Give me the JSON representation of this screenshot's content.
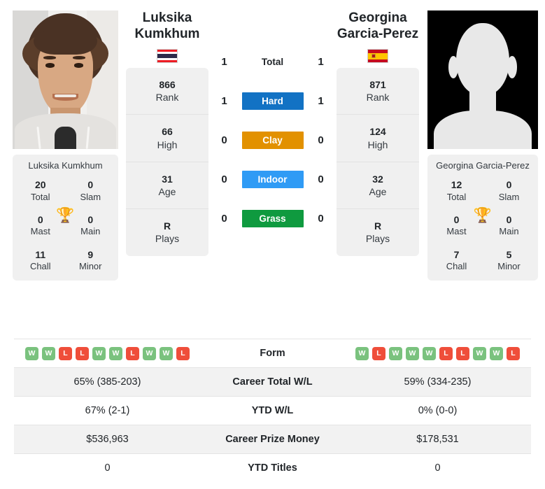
{
  "players": {
    "left": {
      "name_line1": "Luksika",
      "name_line2": "Kumkhum",
      "full_name": "Luksika Kumkhum",
      "flag": "thailand-flag",
      "photo": "player-portrait-photo",
      "rank": "866",
      "rank_label": "Rank",
      "high": "66",
      "high_label": "High",
      "age": "31",
      "age_label": "Age",
      "plays": "R",
      "plays_label": "Plays",
      "titles": {
        "total": "20",
        "total_label": "Total",
        "slam": "0",
        "slam_label": "Slam",
        "mast": "0",
        "mast_label": "Mast",
        "main": "0",
        "main_label": "Main",
        "chall": "11",
        "chall_label": "Chall",
        "minor": "9",
        "minor_label": "Minor"
      },
      "form": [
        "W",
        "W",
        "L",
        "L",
        "W",
        "W",
        "L",
        "W",
        "W",
        "L"
      ],
      "career_total_wl": "65% (385-203)",
      "ytd_wl": "67% (2-1)",
      "career_prize_money": "$536,963",
      "ytd_titles": "0"
    },
    "right": {
      "name_line1": "Georgina",
      "name_line2": "Garcia-Perez",
      "full_name": "Georgina Garcia-Perez",
      "flag": "spain-flag",
      "photo": "player-placeholder-silhouette",
      "rank": "871",
      "rank_label": "Rank",
      "high": "124",
      "high_label": "High",
      "age": "32",
      "age_label": "Age",
      "plays": "R",
      "plays_label": "Plays",
      "titles": {
        "total": "12",
        "total_label": "Total",
        "slam": "0",
        "slam_label": "Slam",
        "mast": "0",
        "mast_label": "Mast",
        "main": "0",
        "main_label": "Main",
        "chall": "7",
        "chall_label": "Chall",
        "minor": "5",
        "minor_label": "Minor"
      },
      "form": [
        "W",
        "L",
        "W",
        "W",
        "W",
        "L",
        "L",
        "W",
        "W",
        "L"
      ],
      "career_total_wl": "59% (334-235)",
      "ytd_wl": "0% (0-0)",
      "career_prize_money": "$178,531",
      "ytd_titles": "0"
    }
  },
  "head_to_head": [
    {
      "surface": "Total",
      "left": "1",
      "right": "1",
      "color": "transparent",
      "plain": true
    },
    {
      "surface": "Hard",
      "left": "1",
      "right": "1",
      "color": "#1272c4",
      "plain": false
    },
    {
      "surface": "Clay",
      "left": "0",
      "right": "0",
      "color": "#e29100",
      "plain": false
    },
    {
      "surface": "Indoor",
      "left": "0",
      "right": "0",
      "color": "#2f9bf5",
      "plain": false
    },
    {
      "surface": "Grass",
      "left": "0",
      "right": "0",
      "color": "#0f9a3f",
      "plain": false
    }
  ],
  "stats_rows": [
    {
      "label": "Form",
      "type": "form",
      "left_key": "form",
      "right_key": "form"
    },
    {
      "label": "Career Total W/L",
      "type": "text",
      "left_key": "career_total_wl",
      "right_key": "career_total_wl"
    },
    {
      "label": "YTD W/L",
      "type": "text",
      "left_key": "ytd_wl",
      "right_key": "ytd_wl"
    },
    {
      "label": "Career Prize Money",
      "type": "text",
      "left_key": "career_prize_money",
      "right_key": "career_prize_money"
    },
    {
      "label": "YTD Titles",
      "type": "text",
      "left_key": "ytd_titles",
      "right_key": "ytd_titles"
    }
  ],
  "icons": {
    "trophy": "🏆"
  },
  "colors": {
    "win_badge": "#7ac27e",
    "loss_badge": "#ef4e3a",
    "hard": "#1272c4",
    "clay": "#e29100",
    "indoor": "#2f9bf5",
    "grass": "#0f9a3f",
    "trophy": "#4a7ebb",
    "card_bg": "#f0f0f0",
    "row_shade": "#f2f2f2"
  }
}
